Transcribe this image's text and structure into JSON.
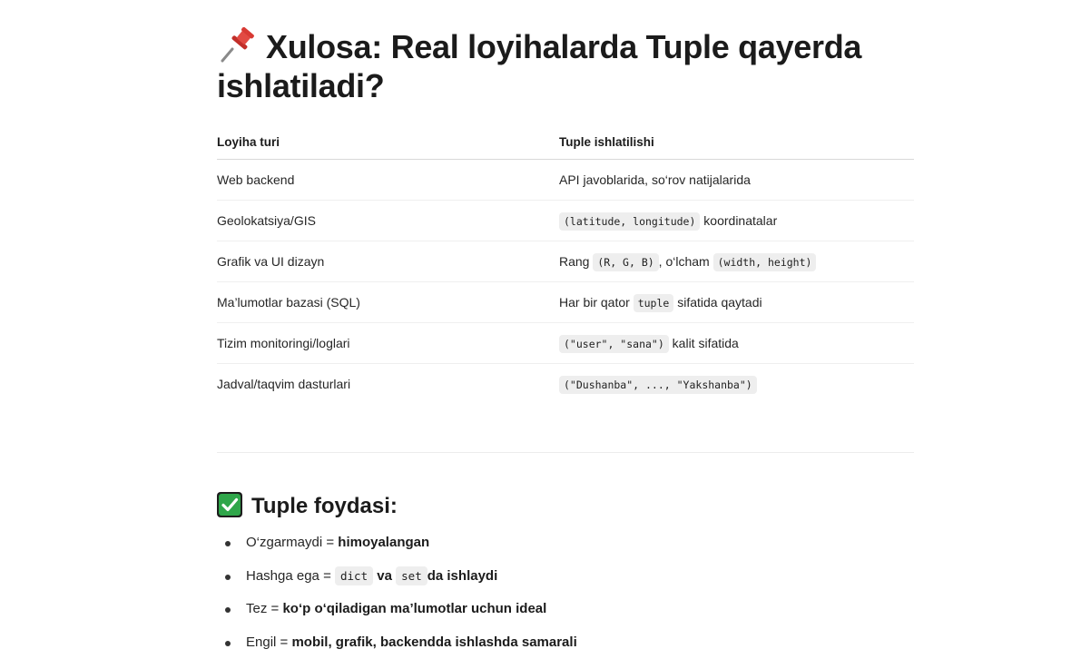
{
  "heading": {
    "icon": "pushpin-icon",
    "text": "Xulosa: Real loyihalarda Tuple qayerda ishlatiladi?"
  },
  "table": {
    "headers": [
      "Loyiha turi",
      "Tuple ishlatilishi"
    ],
    "rows": [
      {
        "type": "Web backend",
        "usage": {
          "text": "API javoblarida, so‘rov natijalarida"
        }
      },
      {
        "type": "Geolokatsiya/GIS",
        "usage": {
          "code": "(latitude, longitude)",
          "after": " koordinatalar"
        }
      },
      {
        "type": "Grafik va UI dizayn",
        "usage": {
          "pre": "Rang ",
          "code1": "(R, G, B)",
          "mid": ", o‘lcham ",
          "code2": "(width, height)"
        }
      },
      {
        "type": "Ma’lumotlar bazasi (SQL)",
        "usage": {
          "pre": "Har bir qator ",
          "code": "tuple",
          "after": " sifatida qaytadi"
        }
      },
      {
        "type": "Tizim monitoringi/loglari",
        "usage": {
          "code": "(\"user\", \"sana\")",
          "after": " kalit sifatida"
        }
      },
      {
        "type": "Jadval/taqvim dasturlari",
        "usage": {
          "code": "(\"Dushanba\", ..., \"Yakshanba\")"
        }
      }
    ]
  },
  "benefits": {
    "icon": "check-mark-icon",
    "title": "Tuple foydasi:",
    "items": [
      {
        "pre": "O‘zgarmaydi = ",
        "bold": "himoyalangan"
      },
      {
        "pre": "Hashga ega = ",
        "code1": "dict",
        "mid": " va ",
        "code2": "set",
        "bold": "da ishlaydi"
      },
      {
        "pre": "Tez = ",
        "bold": "ko‘p o‘qiladigan ma’lumotlar uchun ideal"
      },
      {
        "pre": "Engil = ",
        "bold": "mobil, grafik, backendda ishlashda samarali"
      }
    ]
  },
  "colors": {
    "check_green": "#2fa64a",
    "pin_red": "#d83a34",
    "code_bg": "#eeeeee"
  }
}
